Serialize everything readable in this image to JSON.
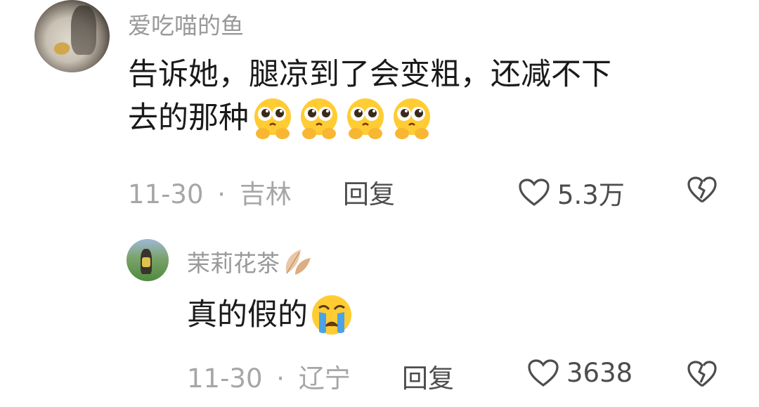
{
  "comments": [
    {
      "username": "爱吃喵的鱼",
      "text_line1": "告诉她，腿凉到了会变粗，还减不下",
      "text_line2": "去的那种",
      "emoji_icons": [
        "pleading-face-icon",
        "pleading-face-icon",
        "pleading-face-icon",
        "pleading-face-icon"
      ],
      "date": "11-30",
      "location": "吉林",
      "separator": "·",
      "reply_label": "回复",
      "like_count": "5.3万"
    },
    {
      "username": "茉莉花茶",
      "badge_icon": "leaf-badge-icon",
      "text": "真的假的",
      "emoji_icons": [
        "crying-face-icon"
      ],
      "date": "11-30",
      "location": "辽宁",
      "separator": "·",
      "reply_label": "回复",
      "like_count": "3638"
    }
  ],
  "colors": {
    "text_primary": "#1a1a1a",
    "text_secondary": "#999999",
    "icon_gray": "#4d4d4d"
  }
}
